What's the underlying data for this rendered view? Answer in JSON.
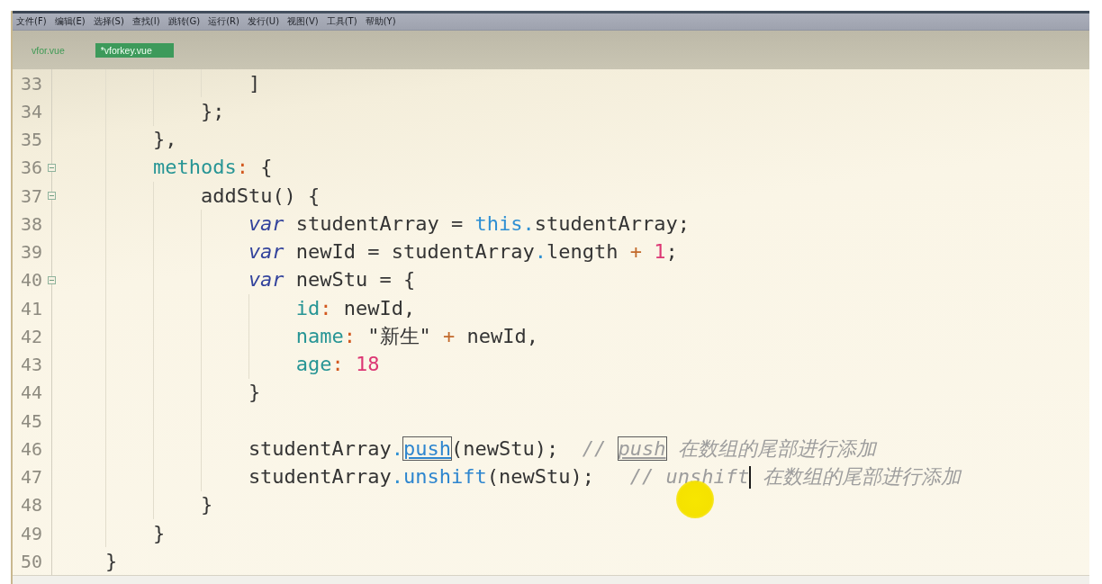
{
  "menu": [
    {
      "label": "文件(F)"
    },
    {
      "label": "编辑(E)"
    },
    {
      "label": "选择(S)"
    },
    {
      "label": "查找(I)"
    },
    {
      "label": "跳转(G)"
    },
    {
      "label": "运行(R)"
    },
    {
      "label": "发行(U)"
    },
    {
      "label": "视图(V)"
    },
    {
      "label": "工具(T)"
    },
    {
      "label": "帮助(Y)"
    }
  ],
  "tabs": [
    {
      "label": "vfor.vue",
      "selected": false
    },
    {
      "label": "*vforkey.vue",
      "selected": true
    }
  ],
  "editor": {
    "lines": [
      {
        "number": "33",
        "foldable": false,
        "tokens": [
          {
            "text": "                ]",
            "kind": "plain",
            "match": false
          }
        ]
      },
      {
        "number": "34",
        "foldable": false,
        "tokens": [
          {
            "text": "            };",
            "kind": "plain",
            "match": false
          }
        ]
      },
      {
        "number": "35",
        "foldable": false,
        "tokens": [
          {
            "text": "        },",
            "kind": "plain",
            "match": false
          }
        ]
      },
      {
        "number": "36",
        "foldable": true,
        "tokens": [
          {
            "text": "        methods",
            "kind": "property",
            "match": false
          },
          {
            "text": ":",
            "kind": "colon",
            "match": false
          },
          {
            "text": " {",
            "kind": "plain",
            "match": false
          }
        ]
      },
      {
        "number": "37",
        "foldable": true,
        "tokens": [
          {
            "text": "            addStu() {",
            "kind": "plain",
            "match": false
          }
        ]
      },
      {
        "number": "38",
        "foldable": false,
        "tokens": [
          {
            "text": "                var",
            "kind": "keyword",
            "match": false
          },
          {
            "text": " studentArray = ",
            "kind": "plain",
            "match": false
          },
          {
            "text": "this",
            "kind": "this",
            "match": false
          },
          {
            "text": ".",
            "kind": "dot",
            "match": false
          },
          {
            "text": "studentArray;",
            "kind": "plain",
            "match": false
          }
        ]
      },
      {
        "number": "39",
        "foldable": false,
        "tokens": [
          {
            "text": "                var",
            "kind": "keyword",
            "match": false
          },
          {
            "text": " newId = studentArray",
            "kind": "plain",
            "match": false
          },
          {
            "text": ".",
            "kind": "dot",
            "match": false
          },
          {
            "text": "length ",
            "kind": "plain",
            "match": false
          },
          {
            "text": "+ ",
            "kind": "operator",
            "match": false
          },
          {
            "text": "1",
            "kind": "number",
            "match": false
          },
          {
            "text": ";",
            "kind": "plain",
            "match": false
          }
        ]
      },
      {
        "number": "40",
        "foldable": true,
        "tokens": [
          {
            "text": "                var",
            "kind": "keyword",
            "match": false
          },
          {
            "text": " newStu = {",
            "kind": "plain",
            "match": false
          }
        ]
      },
      {
        "number": "41",
        "foldable": false,
        "tokens": [
          {
            "text": "                    id",
            "kind": "property",
            "match": false
          },
          {
            "text": ":",
            "kind": "colon",
            "match": false
          },
          {
            "text": " newId,",
            "kind": "plain",
            "match": false
          }
        ]
      },
      {
        "number": "42",
        "foldable": false,
        "tokens": [
          {
            "text": "                    name",
            "kind": "property",
            "match": false
          },
          {
            "text": ":",
            "kind": "colon",
            "match": false
          },
          {
            "text": " \"新生\" ",
            "kind": "plain",
            "match": false
          },
          {
            "text": "+",
            "kind": "operator",
            "match": false
          },
          {
            "text": " newId,",
            "kind": "plain",
            "match": false
          }
        ]
      },
      {
        "number": "43",
        "foldable": false,
        "tokens": [
          {
            "text": "                    age",
            "kind": "property",
            "match": false
          },
          {
            "text": ": ",
            "kind": "colon",
            "match": false
          },
          {
            "text": "18",
            "kind": "number",
            "match": false
          }
        ]
      },
      {
        "number": "44",
        "foldable": false,
        "tokens": [
          {
            "text": "                }",
            "kind": "plain",
            "match": false
          }
        ]
      },
      {
        "number": "45",
        "foldable": false
      },
      {
        "number": "46",
        "foldable": false,
        "tokens": [
          {
            "text": "                studentArray",
            "kind": "plain",
            "match": false
          },
          {
            "text": ".",
            "kind": "dot",
            "match": false
          },
          {
            "text": "push",
            "kind": "method",
            "match": true
          },
          {
            "text": "(newStu);  ",
            "kind": "plain",
            "match": false
          },
          {
            "text": "// ",
            "kind": "comment",
            "match": false
          },
          {
            "text": "push",
            "kind": "comment",
            "match": true
          },
          {
            "text": " 在数组的尾部进行添加",
            "kind": "comment",
            "match": false
          }
        ]
      },
      {
        "number": "47",
        "foldable": false,
        "tokens": [
          {
            "text": "                studentArray",
            "kind": "plain",
            "match": false
          },
          {
            "text": ".",
            "kind": "dot",
            "match": false
          },
          {
            "text": "unshift",
            "kind": "method",
            "match": false
          },
          {
            "text": "(newStu);   ",
            "kind": "plain",
            "match": false
          },
          {
            "text": "// unshift",
            "kind": "comment",
            "match": false
          },
          {
            "kind": "caret",
            "match": false
          },
          {
            "text": " 在数组的尾部进行添加",
            "kind": "comment",
            "match": false
          }
        ]
      },
      {
        "number": "48",
        "foldable": false,
        "tokens": [
          {
            "text": "            }",
            "kind": "plain",
            "match": false
          }
        ]
      },
      {
        "number": "49",
        "foldable": false,
        "tokens": [
          {
            "text": "        }",
            "kind": "plain",
            "match": false
          }
        ]
      },
      {
        "number": "50",
        "foldable": false,
        "tokens": [
          {
            "text": "    }",
            "kind": "plain",
            "match": false
          }
        ]
      }
    ]
  }
}
